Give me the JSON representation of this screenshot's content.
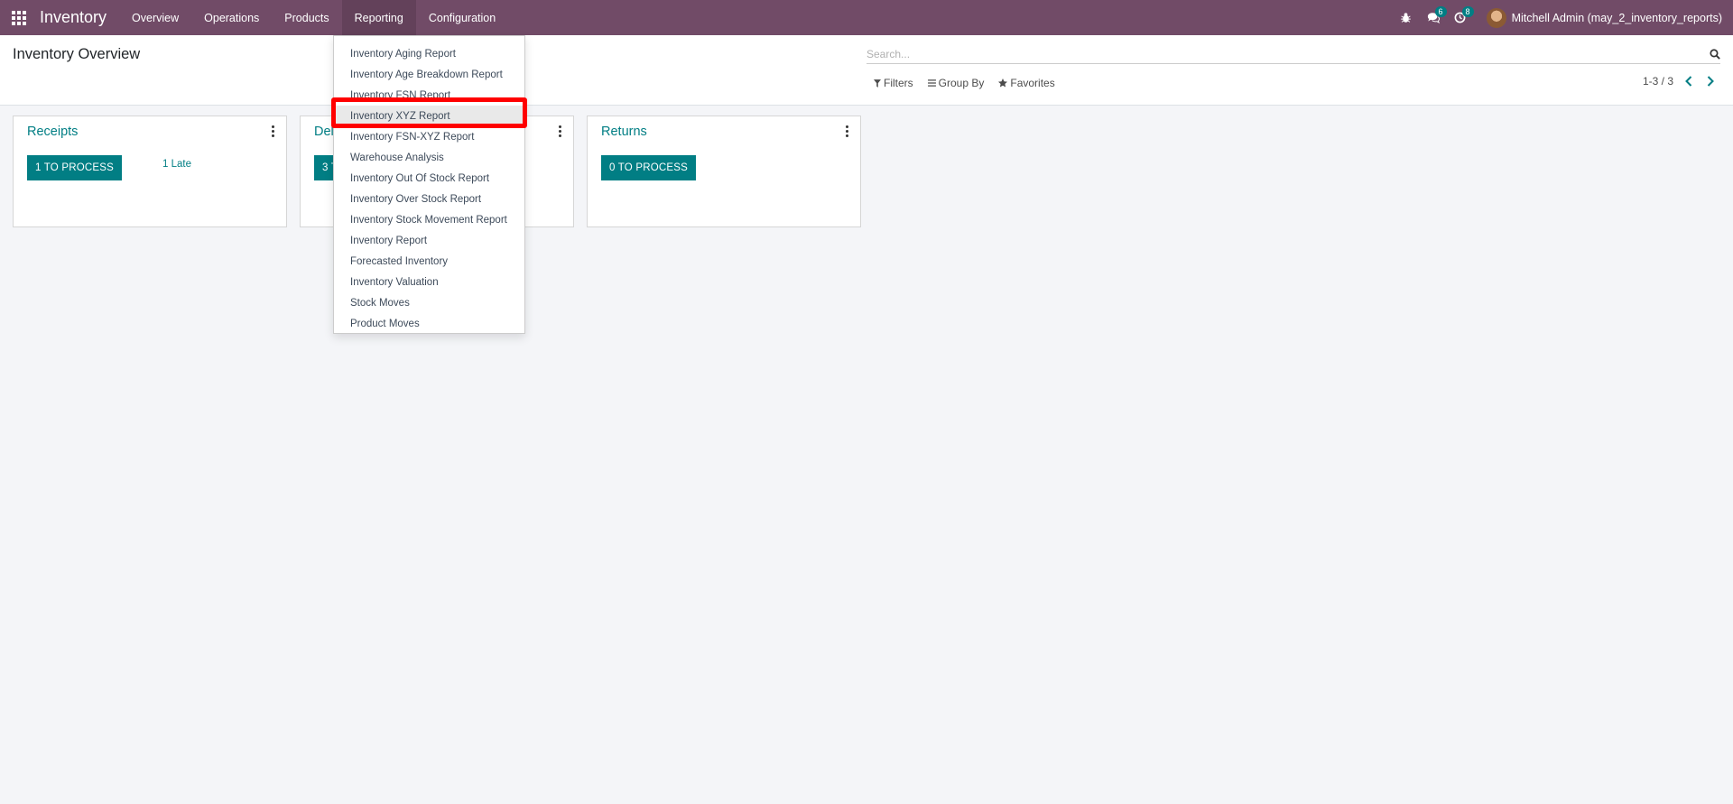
{
  "navbar": {
    "brand": "Inventory",
    "menu": [
      "Overview",
      "Operations",
      "Products",
      "Reporting",
      "Configuration"
    ],
    "active_menu": "Reporting",
    "messages_count": "6",
    "activities_count": "8",
    "user_name": "Mitchell Admin (may_2_inventory_reports)"
  },
  "control_panel": {
    "title": "Inventory Overview",
    "search_placeholder": "Search...",
    "filters_label": "Filters",
    "group_by_label": "Group By",
    "favorites_label": "Favorites",
    "pager": "1-3 / 3"
  },
  "cards": [
    {
      "title": "Receipts",
      "button": "1 TO PROCESS",
      "late": "1 Late"
    },
    {
      "title": "Delivery Orders",
      "button": "3 TO PROCESS"
    },
    {
      "title": "Returns",
      "button": "0 TO PROCESS"
    }
  ],
  "reporting_menu": [
    "Inventory Aging Report",
    "Inventory Age Breakdown Report",
    "Inventory FSN Report",
    "Inventory XYZ Report",
    "Inventory FSN-XYZ Report",
    "Warehouse Analysis",
    "Inventory Out Of Stock Report",
    "Inventory Over Stock Report",
    "Inventory Stock Movement Report",
    "Inventory Report",
    "Forecasted Inventory",
    "Inventory Valuation",
    "Stock Moves",
    "Product Moves"
  ],
  "highlighted_item": "Inventory XYZ Report",
  "colors": {
    "navbar": "#714b67",
    "primary": "#017e84",
    "highlight": "#ff0000"
  }
}
